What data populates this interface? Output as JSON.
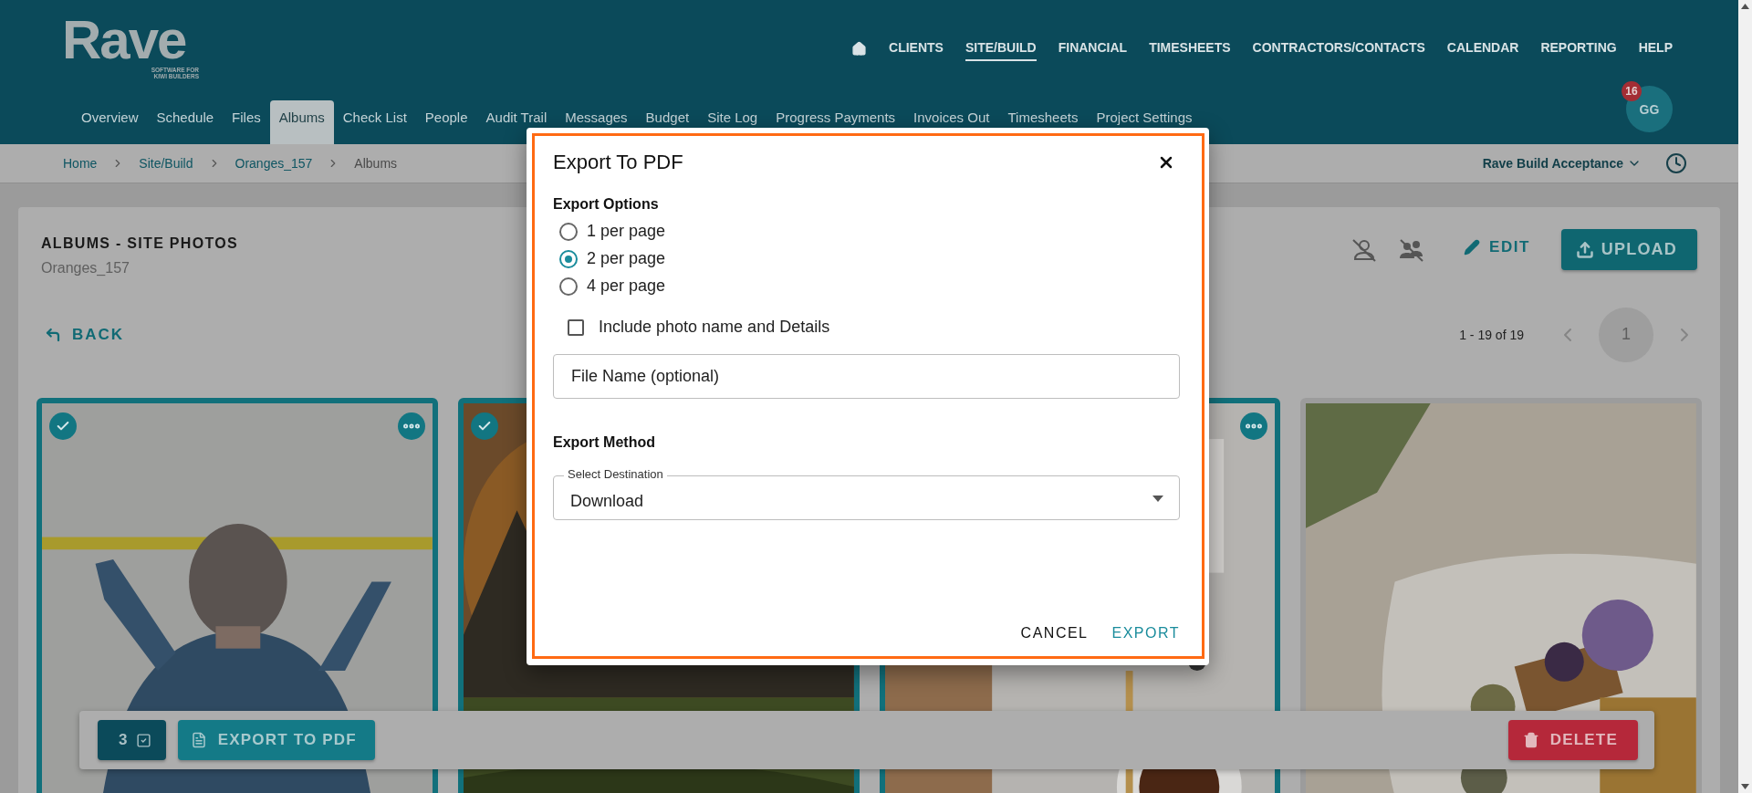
{
  "logo": {
    "name": "Rave",
    "tagline_1": "SOFTWARE FOR",
    "tagline_2": "KIWI BUILDERS"
  },
  "main_nav": [
    {
      "label": "CLIENTS",
      "selected": false
    },
    {
      "label": "SITE/BUILD",
      "selected": true
    },
    {
      "label": "FINANCIAL",
      "selected": false
    },
    {
      "label": "TIMESHEETS",
      "selected": false
    },
    {
      "label": "CONTRACTORS/CONTACTS",
      "selected": false
    },
    {
      "label": "CALENDAR",
      "selected": false
    },
    {
      "label": "REPORTING",
      "selected": false
    },
    {
      "label": "HELP",
      "selected": false
    }
  ],
  "user": {
    "initials": "GG",
    "notifications": "16"
  },
  "sub_tabs": [
    {
      "label": "Overview",
      "selected": false
    },
    {
      "label": "Schedule",
      "selected": false
    },
    {
      "label": "Files",
      "selected": false
    },
    {
      "label": "Albums",
      "selected": true
    },
    {
      "label": "Check List",
      "selected": false
    },
    {
      "label": "People",
      "selected": false
    },
    {
      "label": "Audit Trail",
      "selected": false
    },
    {
      "label": "Messages",
      "selected": false
    },
    {
      "label": "Budget",
      "selected": false
    },
    {
      "label": "Site Log",
      "selected": false
    },
    {
      "label": "Progress Payments",
      "selected": false
    },
    {
      "label": "Invoices Out",
      "selected": false
    },
    {
      "label": "Timesheets",
      "selected": false
    },
    {
      "label": "Project Settings",
      "selected": false
    }
  ],
  "breadcrumb": [
    "Home",
    "Site/Build",
    "Oranges_157",
    "Albums"
  ],
  "project_selector": "Rave Build Acceptance",
  "album": {
    "title": "ALBUMS - SITE PHOTOS",
    "subtitle": "Oranges_157"
  },
  "actions": {
    "edit": "EDIT",
    "upload": "UPLOAD"
  },
  "back": "BACK",
  "pagination": {
    "range": "1 - 19 of 19",
    "pages": [
      {
        "label": "1",
        "selected": true
      }
    ]
  },
  "photos": [
    {
      "kind": "picture",
      "selected": true,
      "tick": true,
      "menu": true
    },
    {
      "kind": "picture",
      "selected": true,
      "tick": true,
      "menu": false
    },
    {
      "kind": "picture",
      "selected": true,
      "tick": false,
      "menu": true
    },
    {
      "kind": "picture",
      "selected": false,
      "tick": false,
      "menu": false
    }
  ],
  "selection_bar": {
    "count": "3",
    "export": "EXPORT TO PDF",
    "delete": "DELETE"
  },
  "dialog": {
    "title": "Export To PDF",
    "options_label": "Export Options",
    "options": [
      {
        "label": "1 per page",
        "selected": false
      },
      {
        "label": "2 per page",
        "selected": true
      },
      {
        "label": "4 per page",
        "selected": false
      }
    ],
    "include_details": {
      "label": "Include photo name and Details",
      "checked": false
    },
    "file_name": {
      "placeholder": "File Name (optional)"
    },
    "method_label": "Export Method",
    "destination": {
      "label": "Select Destination",
      "value": "Download"
    },
    "buttons": {
      "cancel": "CANCEL",
      "export": "EXPORT"
    }
  }
}
